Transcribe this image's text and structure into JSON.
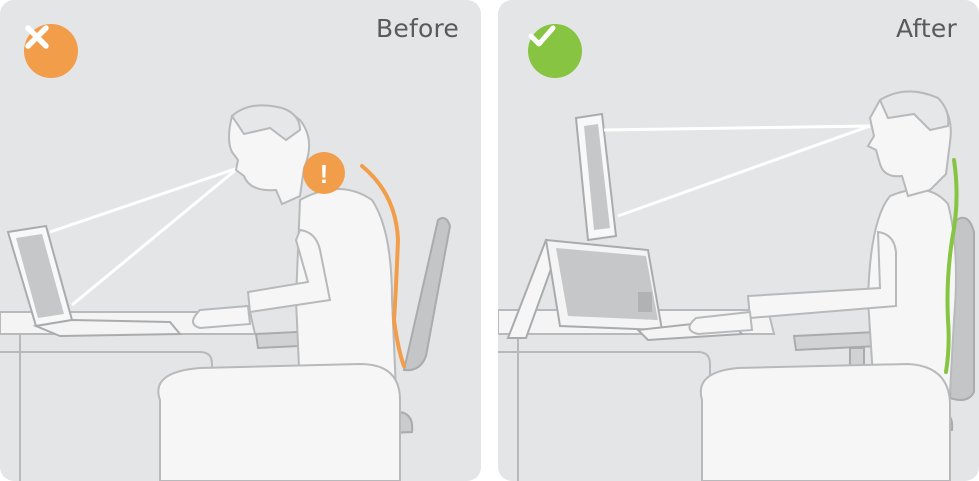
{
  "panels": [
    {
      "label": "Before",
      "status_icon": "x-icon",
      "status_color": "#f29d4a",
      "alert_icon": "exclamation-icon",
      "spine_color": "#f29d4a"
    },
    {
      "label": "After",
      "status_icon": "check-icon",
      "status_color": "#86c441",
      "spine_color": "#86c441"
    }
  ],
  "colors": {
    "panel_bg": "#e4e5e6",
    "figure_fill": "#f6f6f6",
    "outline": "#b7b9bb",
    "chair_back": "#c3c5c7",
    "sight_line": "#ffffff"
  },
  "alert": {
    "glyph": "!"
  }
}
